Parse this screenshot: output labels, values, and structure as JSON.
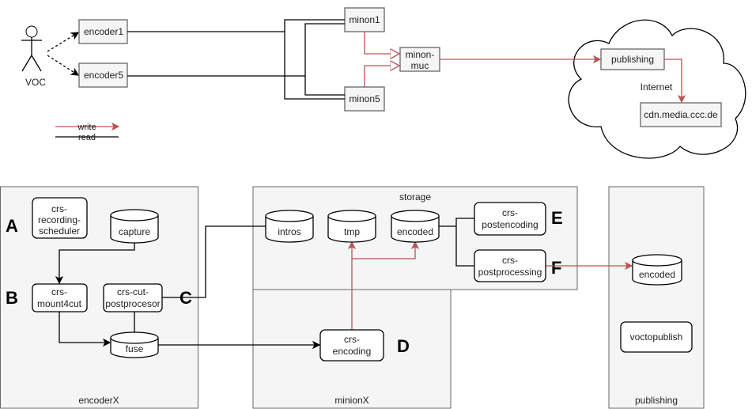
{
  "actor": {
    "label": "VOC"
  },
  "top": {
    "encoder1": "encoder1",
    "encoder5": "encoder5",
    "minon1": "minon1",
    "minon5": "minon5",
    "minon_muc": [
      "minon-",
      "muc"
    ],
    "publishing": "publishing",
    "internet": "Internet",
    "cdn": "cdn.media.ccc.de"
  },
  "legend": {
    "write": "write",
    "read": "read"
  },
  "containers": {
    "encoderX": "encoderX",
    "storage": "storage",
    "minionX": "minionX",
    "publishing": "publishing"
  },
  "nodes": {
    "scheduler": [
      "crs-",
      "recording-",
      "scheduler"
    ],
    "capture": "capture",
    "mount4cut": [
      "crs-",
      "mount4cut"
    ],
    "cut_post": [
      "crs-cut-",
      "postprocesor"
    ],
    "fuse": "fuse",
    "intros": "intros",
    "tmp": "tmp",
    "encoded": "encoded",
    "encoding": [
      "crs-",
      "encoding"
    ],
    "postencoding": [
      "crs-",
      "postencoding"
    ],
    "postprocessing": [
      "crs-",
      "postprocessing"
    ],
    "pub_encoded": "encoded",
    "voctopublish": "voctopublish"
  },
  "step_labels": {
    "A": "A",
    "B": "B",
    "C": "C",
    "D": "D",
    "E": "E",
    "F": "F"
  },
  "colors": {
    "write": "#b85450",
    "read": "#000000",
    "box_fill": "#f5f5f5"
  }
}
